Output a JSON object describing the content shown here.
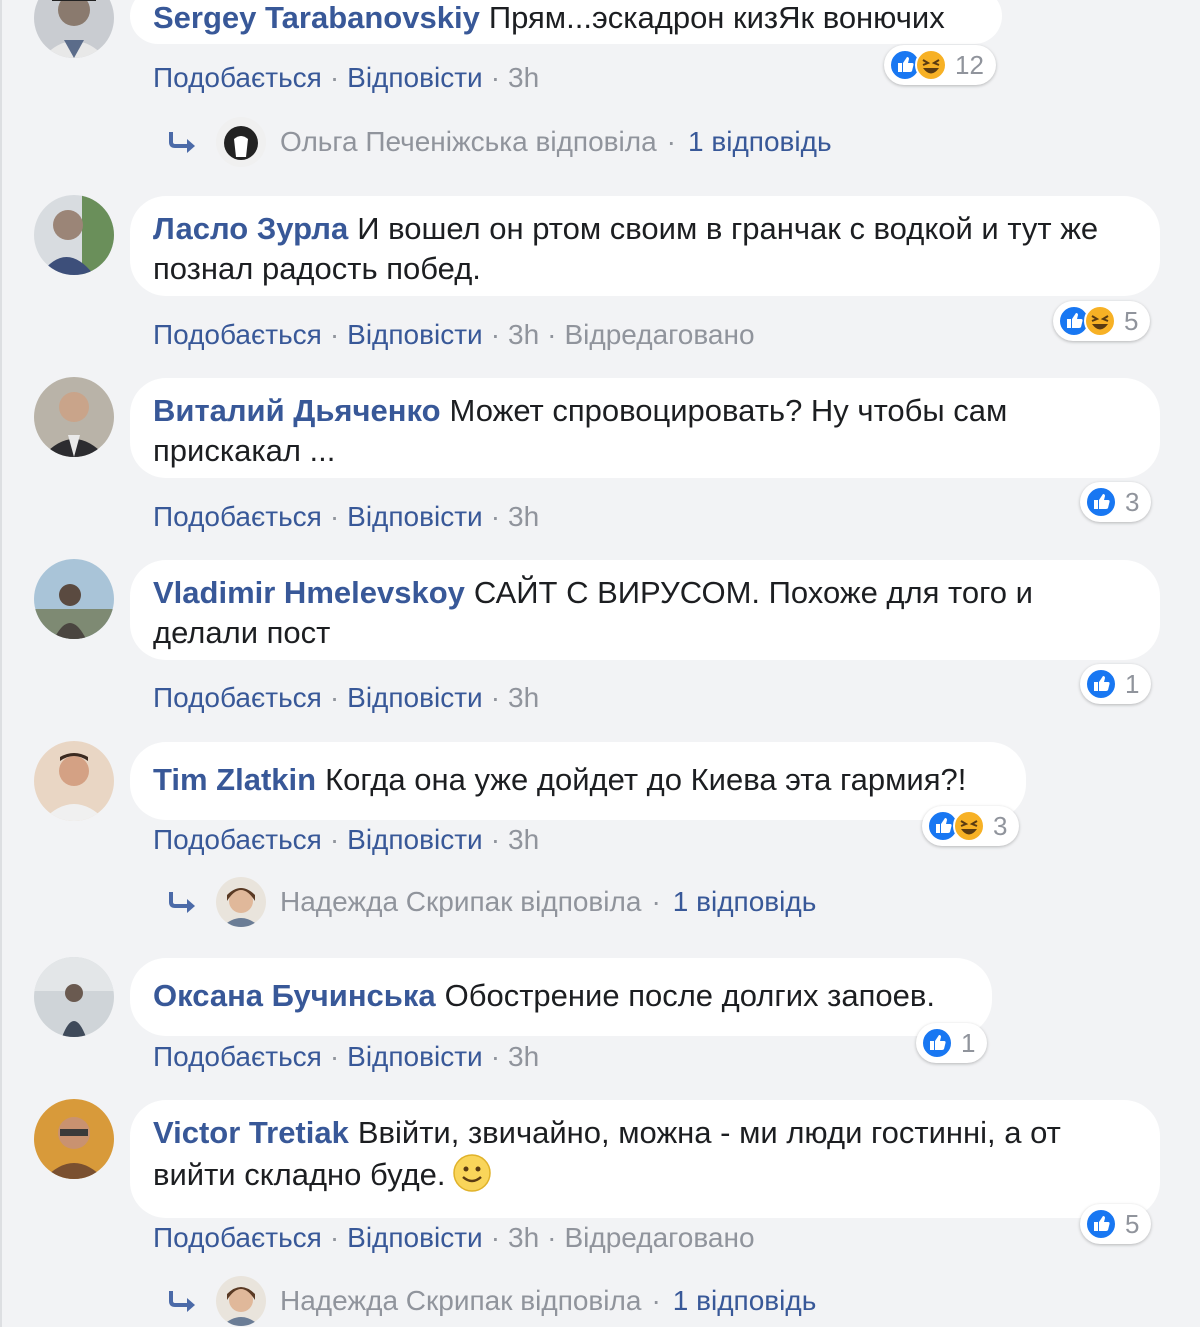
{
  "ui": {
    "like_label": "Подобається",
    "reply_label": "Відповісти",
    "edited_label": "Відредаговано",
    "separator": "·"
  },
  "comments": [
    {
      "author": "Sergey Tarabanovskiy",
      "text": "Прям...эскадрон кизЯк вонючих",
      "time": "3h",
      "edited": false,
      "reaction_icons": [
        "like-icon",
        "haha-icon"
      ],
      "reaction_count": "12",
      "reply": {
        "avatar": "reply-avatar",
        "label": "Ольга Печеніжська відповіла",
        "count": "1 відповідь"
      }
    },
    {
      "author": "Ласло Зурла",
      "text": "И вошел он ртом своим в гранчак с водкой и тут же познал радость побед.",
      "time": "3h",
      "edited": true,
      "reaction_icons": [
        "like-icon",
        "haha-icon"
      ],
      "reaction_count": "5"
    },
    {
      "author": "Виталий Дьяченко",
      "text": "Может спровоцировать? Ну чтобы сам прискакал ...",
      "time": "3h",
      "edited": false,
      "reaction_icons": [
        "like-icon"
      ],
      "reaction_count": "3"
    },
    {
      "author": "Vladimir Hmelevskoy",
      "text": "САЙТ С ВИРУСОМ. Похоже для того и делали пост",
      "time": "3h",
      "edited": false,
      "reaction_icons": [
        "like-icon"
      ],
      "reaction_count": "1"
    },
    {
      "author": "Tim Zlatkin",
      "text": "Когда она уже дойдет до Киева эта гармия?!",
      "time": "3h",
      "edited": false,
      "reaction_icons": [
        "like-icon",
        "haha-icon"
      ],
      "reaction_count": "3",
      "reply": {
        "avatar": "reply-avatar",
        "label": "Надежда Скрипак відповіла",
        "count": "1 відповідь"
      }
    },
    {
      "author": "Оксана Бучинська",
      "text": "Обострение после долгих запоев.",
      "time": "3h",
      "edited": false,
      "reaction_icons": [
        "like-icon"
      ],
      "reaction_count": "1"
    },
    {
      "author": "Victor Tretiak",
      "text": "Ввійти, звичайно, можна - ми люди гостинні, а от вийти складно буде.",
      "has_smiley": true,
      "time": "3h",
      "edited": true,
      "reaction_icons": [
        "like-icon"
      ],
      "reaction_count": "5",
      "reply": {
        "avatar": "reply-avatar",
        "label": "Надежда Скрипак відповіла",
        "count": "1 відповідь"
      }
    }
  ],
  "colors": {
    "background": "#f2f3f5",
    "bubble": "#ffffff",
    "author": "#385898",
    "meta": "#90949c",
    "like_blue": "#1877f2",
    "haha_yellow": "#f7b125"
  }
}
